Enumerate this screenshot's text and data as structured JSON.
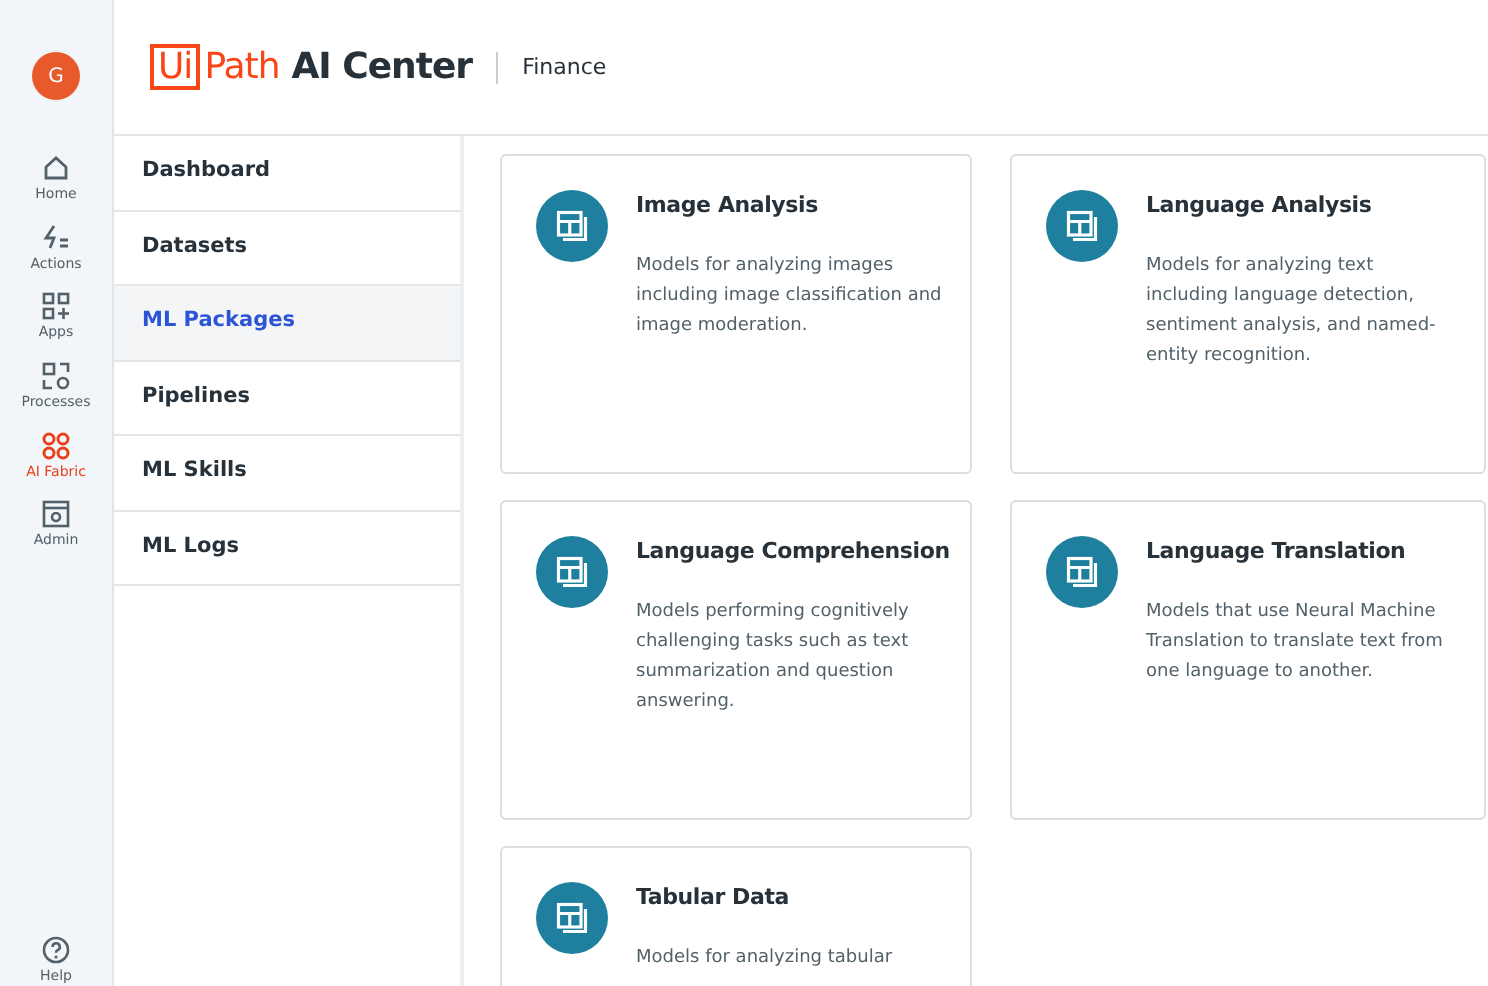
{
  "rail": {
    "avatar": "G",
    "items": [
      {
        "label": "Home",
        "kind": "home",
        "selected": false
      },
      {
        "label": "Actions",
        "kind": "actions",
        "selected": false
      },
      {
        "label": "Apps",
        "kind": "apps",
        "selected": false
      },
      {
        "label": "Processes",
        "kind": "processes",
        "selected": false
      },
      {
        "label": "AI Fabric",
        "kind": "fabric",
        "selected": true
      },
      {
        "label": "Admin",
        "kind": "admin",
        "selected": false
      }
    ],
    "help": "Help"
  },
  "header": {
    "logo_box": "Ui",
    "logo_word": "Path",
    "product": "AI Center",
    "tenant": "Finance"
  },
  "sidebar": {
    "items": [
      {
        "label": "Dashboard",
        "selected": false
      },
      {
        "label": "Datasets",
        "selected": false
      },
      {
        "label": "ML Packages",
        "selected": true
      },
      {
        "label": "Pipelines",
        "selected": false
      },
      {
        "label": "ML Skills",
        "selected": false
      },
      {
        "label": "ML Logs",
        "selected": false
      }
    ]
  },
  "cards": [
    {
      "title": "Image Analysis",
      "description": "Models for analyzing images including image classification and image moderation."
    },
    {
      "title": "Language Analysis",
      "description": "Models for analyzing text including language detection, sentiment analysis, and named-entity recognition."
    },
    {
      "title": "Language Comprehension",
      "description": "Models performing cognitively challenging tasks such as text summarization and question answering."
    },
    {
      "title": "Language Translation",
      "description": "Models that use Neural Machine Translation to translate text from one language to another."
    },
    {
      "title": "Tabular Data",
      "description": "Models for analyzing tabular"
    }
  ]
}
